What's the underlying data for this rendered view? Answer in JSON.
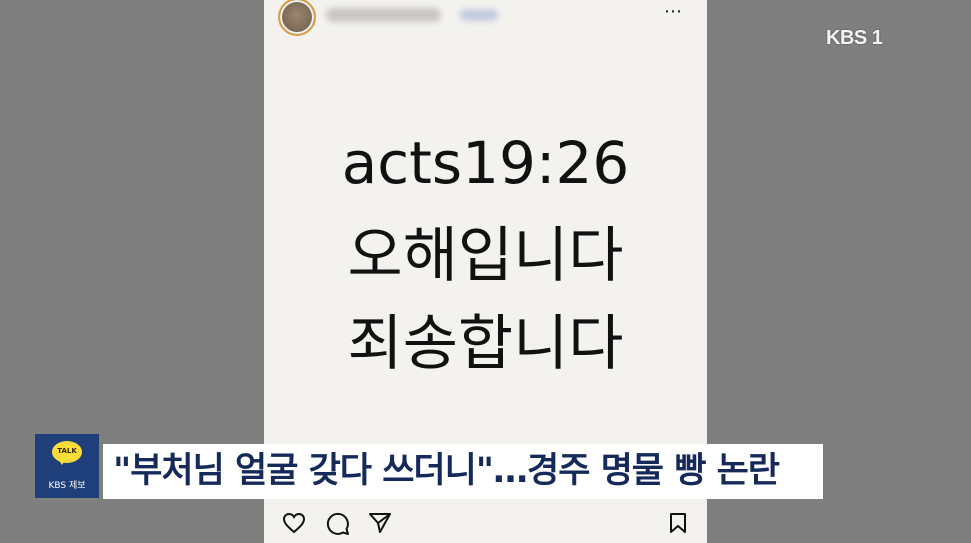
{
  "post": {
    "more_icon": "⋯",
    "lines": [
      "acts19:26",
      "오해입니다",
      "죄송합니다"
    ],
    "actions": [
      "heart-icon",
      "comment-icon",
      "share-icon",
      "bookmark-icon"
    ]
  },
  "broadcaster": {
    "logo": "KBS 1"
  },
  "tip": {
    "badge": "TALK",
    "label": "KBS 제보",
    "badge_color": "#f9dc3a"
  },
  "headline": {
    "text": "\"부처님 얼굴 갖다 쓰더니\"…경주 명물 빵 논란",
    "color": "#152a5a"
  }
}
